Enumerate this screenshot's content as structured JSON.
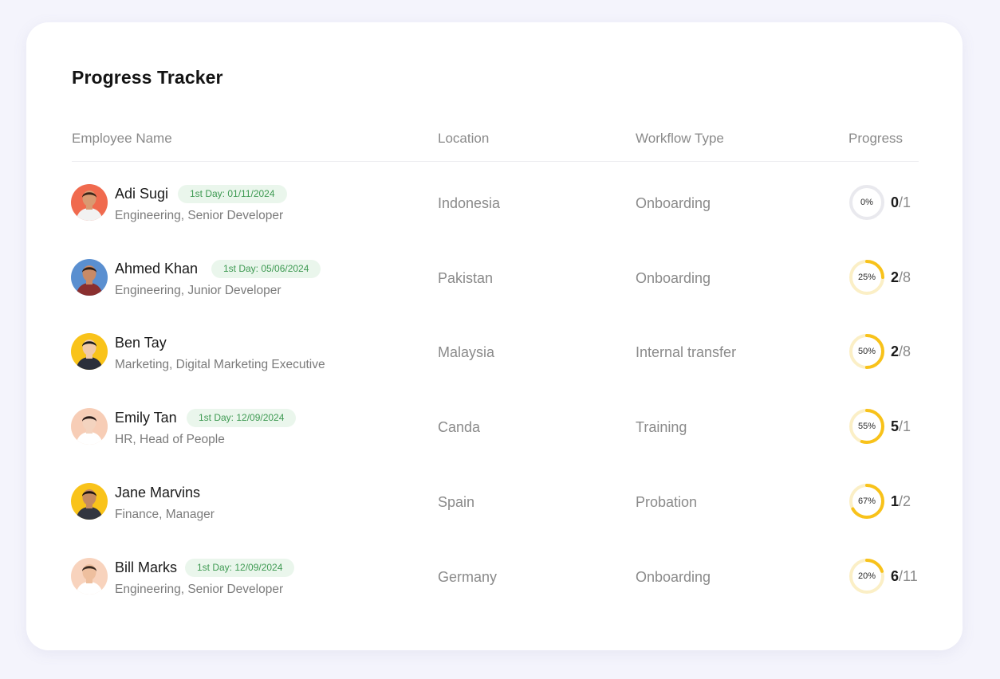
{
  "title": "Progress Tracker",
  "columns": {
    "name": "Employee Name",
    "location": "Location",
    "workflow": "Workflow Type",
    "progress": "Progress"
  },
  "colors": {
    "accent": "#f8c21a",
    "track": "#e9e9ee",
    "badge_bg": "#eaf6ec",
    "badge_text": "#3e9a52"
  },
  "employees": [
    {
      "name": "Adi Sugi",
      "badge": "1st Day: 01/11/2024",
      "role": "Engineering, Senior Developer",
      "location": "Indonesia",
      "workflow": "Onboarding",
      "progress_label": "0%",
      "progress": 0,
      "done": "0",
      "total": "1",
      "avatar": {
        "bg": "#f06a4e",
        "skin": "#d99a72",
        "hair": "#3a2418",
        "shirt": "#f2f2f2"
      }
    },
    {
      "name": "Ahmed Khan",
      "badge": "1st Day: 05/06/2024",
      "role": "Engineering, Junior Developer",
      "location": "Pakistan",
      "workflow": "Onboarding",
      "progress_label": "25%",
      "progress": 0.25,
      "done": "2",
      "total": "8",
      "avatar": {
        "bg": "#5a8fd0",
        "skin": "#c98a66",
        "hair": "#2c1c14",
        "shirt": "#8a2f2f"
      }
    },
    {
      "name": "Ben Tay",
      "badge": "",
      "role": "Marketing, Digital Marketing Executive",
      "location": "Malaysia",
      "workflow": "Internal transfer",
      "progress_label": "50%",
      "progress": 0.5,
      "done": "2",
      "total": "8",
      "avatar": {
        "bg": "#f9c31a",
        "skin": "#f0c9a8",
        "hair": "#1a1a1a",
        "shirt": "#2b2f3a"
      }
    },
    {
      "name": "Emily Tan",
      "badge": "1st Day: 12/09/2024",
      "role": "HR, Head of People",
      "location": "Canda",
      "workflow": "Training",
      "progress_label": "55%",
      "progress": 0.55,
      "done": "5",
      "total": "1",
      "avatar": {
        "bg": "#f7cdb6",
        "skin": "#f3d3bf",
        "hair": "#2a1a16",
        "shirt": "#ffffff"
      }
    },
    {
      "name": "Jane Marvins",
      "badge": "",
      "role": "Finance, Manager",
      "location": "Spain",
      "workflow": "Probation",
      "progress_label": "67%",
      "progress": 0.67,
      "done": "1",
      "total": "2",
      "avatar": {
        "bg": "#f9c31a",
        "skin": "#c48a62",
        "hair": "#1e1410",
        "shirt": "#33363f"
      }
    },
    {
      "name": "Bill Marks",
      "badge": "1st Day: 12/09/2024",
      "role": "Engineering, Senior Developer",
      "location": "Germany",
      "workflow": "Onboarding",
      "progress_label": "20%",
      "progress": 0.2,
      "done": "6",
      "total": "11",
      "avatar": {
        "bg": "#f8d3bd",
        "skin": "#eebf9e",
        "hair": "#3a2a20",
        "shirt": "#ffffff"
      }
    }
  ]
}
